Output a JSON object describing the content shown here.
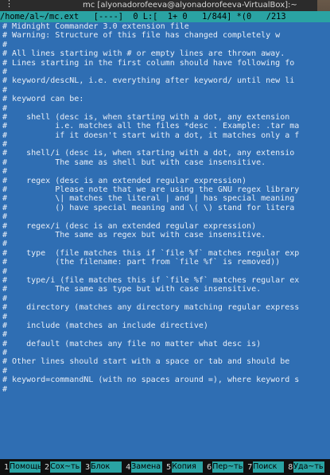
{
  "window": {
    "title": "mc [alyonadorofeeva@alyonadorofeeva-VirtualBox]:~",
    "menu_glyph": "⋮"
  },
  "status": {
    "text": "/home/al~/mc.ext   [----]  0 L:[  1+ 0   1/844] *(0   /213"
  },
  "editor": {
    "lines": [
      "# Midnight Commander 3.0 extension file",
      "# Warning: Structure of this file has changed completely w",
      "#",
      "# All lines starting with # or empty lines are thrown away.",
      "# Lines starting in the first column should have following fo",
      "#",
      "# keyword/descNL, i.e. everything after keyword/ until new li",
      "#",
      "# keyword can be:",
      "#",
      "#    shell (desc is, when starting with a dot, any extension",
      "#          i.e. matches all the files *desc . Example: .tar ma",
      "#          if it doesn't start with a dot, it matches only a f",
      "#",
      "#    shell/i (desc is, when starting with a dot, any extensio",
      "#          The same as shell but with case insensitive.",
      "#",
      "#    regex (desc is an extended regular expression)",
      "#          Please note that we are using the GNU regex library",
      "#          \\| matches the literal | and | has special meaning",
      "#          () have special meaning and \\( \\) stand for litera",
      "#",
      "#    regex/i (desc is an extended regular expression)",
      "#          The same as regex but with case insensitive.",
      "#",
      "#    type  (file matches this if `file %f` matches regular exp",
      "#          (the filename: part from `file %f` is removed))",
      "#",
      "#    type/i (file matches this if `file %f` matches regular ex",
      "#          The same as type but with case insensitive.",
      "#",
      "#    directory (matches any directory matching regular express",
      "#",
      "#    include (matches an include directive)",
      "#",
      "#    default (matches any file no matter what desc is)",
      "#",
      "# Other lines should start with a space or tab and should be",
      "#",
      "# keyword=commandNL (with no spaces around =), where keyword s",
      "#"
    ]
  },
  "fkeys": [
    {
      "num": "1",
      "label": "Помощь"
    },
    {
      "num": "2",
      "label": "Сох~ть"
    },
    {
      "num": "3",
      "label": "Блок"
    },
    {
      "num": "4",
      "label": "Замена"
    },
    {
      "num": "5",
      "label": "Копия"
    },
    {
      "num": "6",
      "label": "Пер~ть"
    },
    {
      "num": "7",
      "label": "Поиск"
    },
    {
      "num": "8",
      "label": "Уда~ть"
    }
  ],
  "colors": {
    "editor_bg": "#2f6eb3",
    "status_bg": "#2aa3a3",
    "fkey_bg": "#2aa3a3"
  }
}
